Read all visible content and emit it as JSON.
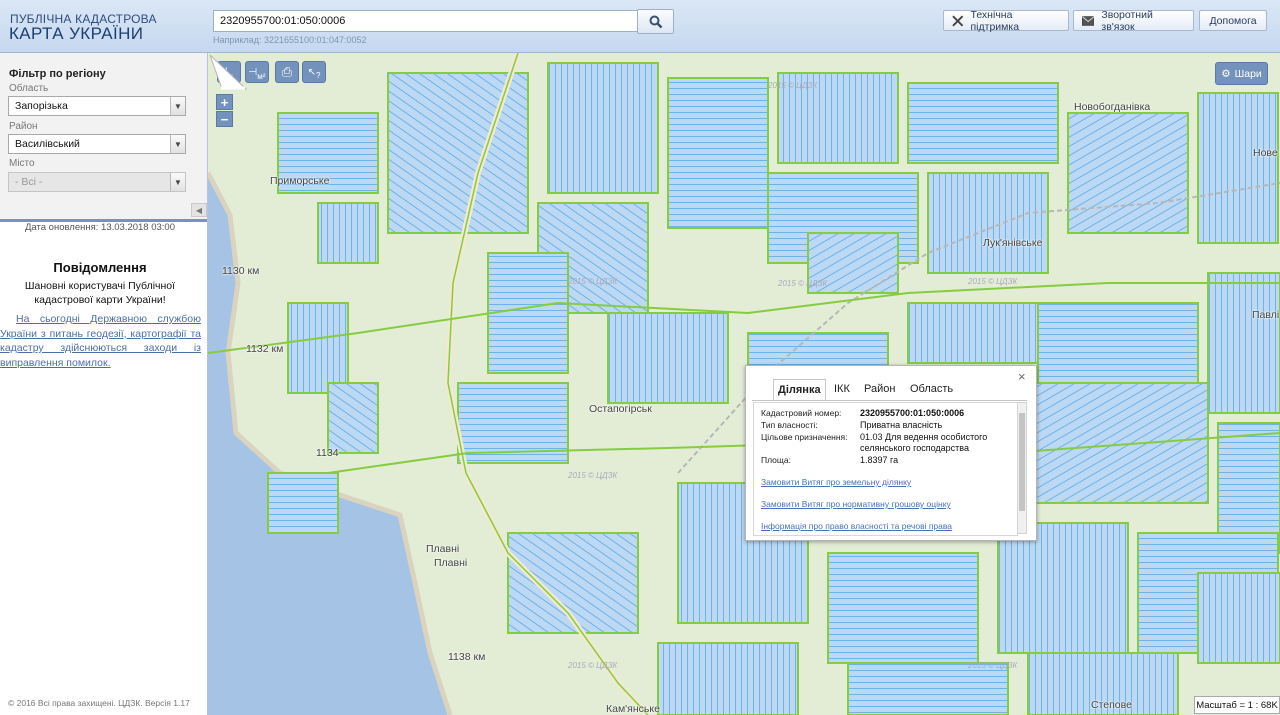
{
  "header": {
    "logo_top": "ПУБЛІЧНА КАДАСТРОВА",
    "logo_bottom": "КАРТА УКРАЇНИ",
    "search_value": "2320955700:01:050:0006",
    "search_hint": "Наприклад: 3221655100:01:047:0052",
    "buttons": {
      "support": "Технічна підтримка",
      "feedback": "Зворотний зв'язок",
      "help": "Допомога"
    }
  },
  "sidebar": {
    "filter_title": "Фільтр по регіону",
    "oblast_label": "Область",
    "oblast_value": "Запорізька",
    "rayon_label": "Район",
    "rayon_value": "Василівський",
    "city_label": "Місто",
    "city_value": "- Всі -",
    "update_date": "Дата оновлення: 13.03.2018 03:00",
    "message_title": "Повідомлення",
    "message_text": "Шановні користувачі Публічної кадастрової карти України!",
    "message_link": "На сьогодні Державною службою України з питань геодезії, картографії та кадастру здійснюються заходи із виправлення помилок.",
    "copyright": "© 2016 Всі права захищені. ЦДЗК. Версія 1.17"
  },
  "map": {
    "toolbar": {
      "measure": "м",
      "area": "м²",
      "print": "⎙",
      "identify": "?"
    },
    "zoom_in": "+",
    "zoom_out": "−",
    "layers_label": "Шари",
    "places": {
      "prymorske": "Приморське",
      "km1130": "1130 км",
      "km1132": "1132 км",
      "km1134": "1134",
      "plavni1": "Плавні",
      "plavni2": "Плавні",
      "km1138": "1138 км",
      "novobohdanivka": "Новобогданівка",
      "lukianivske": "Лук'янівське",
      "pavlivka": "Павлі",
      "novo": "Нове",
      "stepove": "Степове",
      "kamianske": "Кам'янське",
      "kostohirsk": "Остапогірськ"
    },
    "watermark": "2015 © ЦДЗК",
    "scale": "Масштаб = 1 : 68K"
  },
  "popup": {
    "tabs": [
      "Ділянка",
      "ІКК",
      "Район",
      "Область"
    ],
    "cadastral_label": "Кадастровий номер:",
    "cadastral_value": "2320955700:01:050:0006",
    "ownership_label": "Тип власності:",
    "ownership_value": "Приватна власність",
    "purpose_label": "Цільове призначення:",
    "purpose_value": "01.03 Для ведення особистого селянського господарства",
    "area_label": "Площа:",
    "area_value": "1.8397 га",
    "link1": "Замовити Витяг про земельну ділянку",
    "link2": "Замовити Витяг про нормативну грошову оцінку",
    "link3": "Інформація про право власності та речові права",
    "close": "×"
  },
  "colors": {
    "accent": "#7393bd",
    "parcel_fill": "#bcd8f2",
    "parcel_stroke": "#5aa9e8",
    "boundary": "#86cc40"
  }
}
